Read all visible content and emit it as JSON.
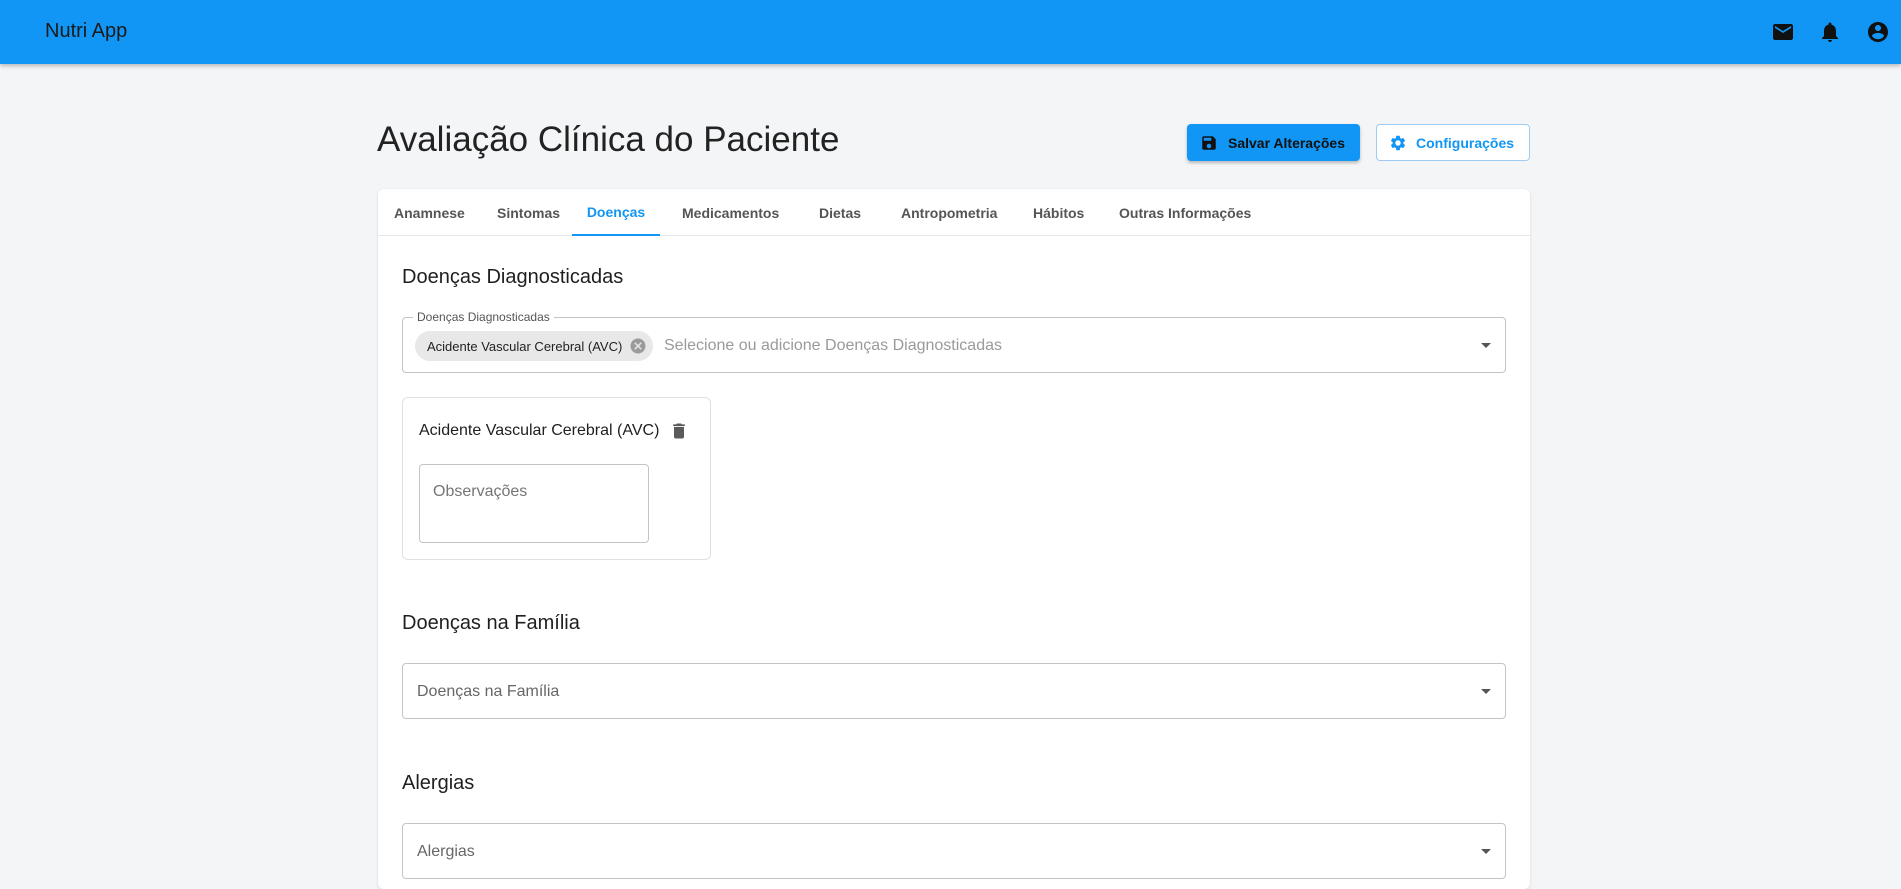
{
  "app": {
    "title": "Nutri App"
  },
  "header_icons": [
    "mail-icon",
    "bell-icon",
    "account-circle-icon"
  ],
  "page": {
    "title": "Avaliação Clínica do Paciente"
  },
  "actions": {
    "save_label": "Salvar Alterações",
    "config_label": "Configurações"
  },
  "tabs": [
    {
      "label": "Anamnese",
      "active": false
    },
    {
      "label": "Sintomas",
      "active": false
    },
    {
      "label": "Doenças",
      "active": true
    },
    {
      "label": "Medicamentos",
      "active": false
    },
    {
      "label": "Dietas",
      "active": false
    },
    {
      "label": "Antropometria",
      "active": false
    },
    {
      "label": "Hábitos",
      "active": false
    },
    {
      "label": "Outras Informações",
      "active": false
    }
  ],
  "diagnosed": {
    "section_title": "Doenças Diagnosticadas",
    "field_label": "Doenças Diagnosticadas",
    "placeholder": "Selecione ou adicione Doenças Diagnosticadas",
    "selected": [
      "Acidente Vascular Cerebral (AVC)"
    ],
    "cards": [
      {
        "name": "Acidente Vascular Cerebral (AVC)",
        "notes_placeholder": "Observações"
      }
    ]
  },
  "family": {
    "section_title": "Doenças na Família",
    "field_label": "Doenças na Família"
  },
  "allergies": {
    "section_title": "Alergias",
    "field_label": "Alergias"
  },
  "colors": {
    "primary": "#1196f5",
    "background": "#f4f5f7",
    "card": "#ffffff"
  }
}
